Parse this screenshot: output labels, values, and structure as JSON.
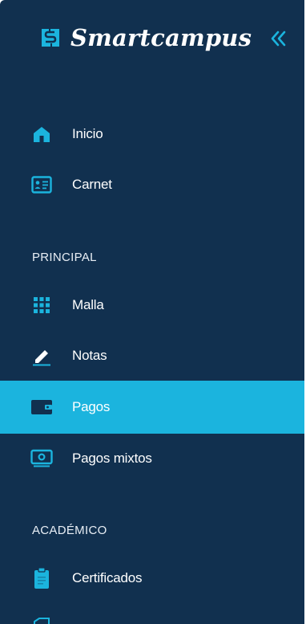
{
  "brand": {
    "name": "Smartcampus"
  },
  "nav": {
    "inicio": "Inicio",
    "carnet": "Carnet",
    "malla": "Malla",
    "notas": "Notas",
    "pagos": "Pagos",
    "pagos_mixtos": "Pagos mixtos",
    "certificados": "Certificados"
  },
  "sections": {
    "principal": "PRINCIPAL",
    "academico": "ACADÉMICO"
  },
  "icons": {
    "brand": "smartcampus-logo-icon",
    "collapse": "double-chevron-left-icon",
    "inicio": "home-icon",
    "carnet": "id-card-icon",
    "malla": "grid-dots-icon",
    "notas": "pencil-icon",
    "pagos": "wallet-icon",
    "pagos_mixtos": "banknote-icon",
    "certificados": "clipboard-icon"
  },
  "colors": {
    "sidebar_bg": "#11304f",
    "accent": "#1bb4de",
    "icon": "#1bb4de",
    "active_bg": "#1bb4de"
  }
}
